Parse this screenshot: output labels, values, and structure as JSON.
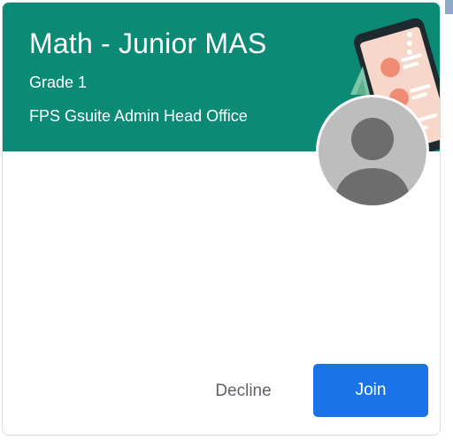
{
  "card": {
    "title": "Math - Junior MAS",
    "section": "Grade 1",
    "owner": "FPS Gsuite Admin Head Office",
    "header_color": "#0b8a76",
    "more_icon": "more-vert-icon",
    "avatar_icon": "person-icon"
  },
  "actions": {
    "decline_label": "Decline",
    "join_label": "Join",
    "join_color": "#1a73e8"
  }
}
